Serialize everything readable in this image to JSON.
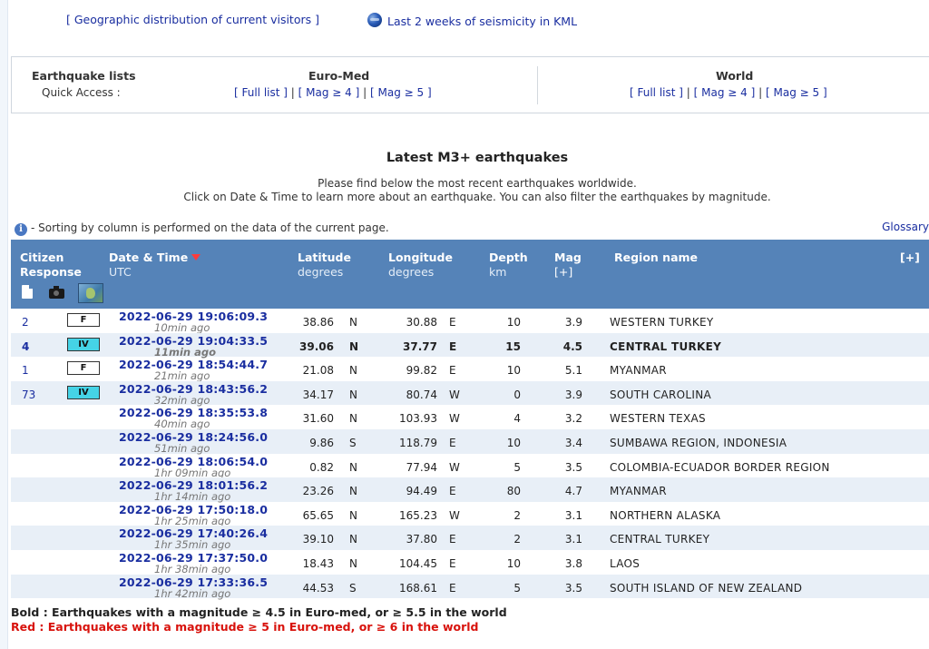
{
  "top_links": {
    "geo": "[ Geographic distribution of current visitors ]",
    "kml": "Last 2 weeks of seismicity in KML"
  },
  "quick_access": {
    "title": "Earthquake lists",
    "subtitle": "Quick Access :",
    "euromed": {
      "title": "Euro-Med",
      "full": "[ Full list ]",
      "mag4": "[ Mag ≥ 4 ]",
      "mag5": "[ Mag ≥ 5 ]"
    },
    "world": {
      "title": "World",
      "full": "[ Full list ]",
      "mag4": "[ Mag ≥ 4 ]",
      "mag5": "[ Mag ≥ 5 ]"
    },
    "separator": "|"
  },
  "main": {
    "title": "Latest M3+ earthquakes",
    "intro1": "Please find below the most recent earthquakes worldwide.",
    "intro2": "Click on Date & Time to learn more about an earthquake. You can also filter the earthquakes by magnitude.",
    "sort_note": "- Sorting by column is performed on the data of the current page.",
    "glossary": "Glossary"
  },
  "table": {
    "headers": {
      "citizen": "Citizen",
      "response": "Response",
      "date": "Date & Time",
      "date_sub": "UTC",
      "lat": "Latitude",
      "lat_sub": "degrees",
      "lon": "Longitude",
      "lon_sub": "degrees",
      "depth": "Depth",
      "depth_sub": "km",
      "mag": "Mag",
      "mag_sub": "[+]",
      "region": "Region name",
      "expand": "[+]"
    },
    "rows": [
      {
        "resp": "2",
        "int": "F",
        "date": "2022-06-29   19:06:09.3",
        "ago": "10min ago",
        "lat": "38.86",
        "ns": "N",
        "lon": "30.88",
        "ew": "E",
        "depth": "10",
        "mag": "3.9",
        "region": "WESTERN TURKEY",
        "bold": false
      },
      {
        "resp": "4",
        "int": "IV",
        "date": "2022-06-29   19:04:33.5",
        "ago": "11min ago",
        "lat": "39.06",
        "ns": "N",
        "lon": "37.77",
        "ew": "E",
        "depth": "15",
        "mag": "4.5",
        "region": "CENTRAL TURKEY",
        "bold": true
      },
      {
        "resp": "1",
        "int": "F",
        "date": "2022-06-29   18:54:44.7",
        "ago": "21min ago",
        "lat": "21.08",
        "ns": "N",
        "lon": "99.82",
        "ew": "E",
        "depth": "10",
        "mag": "5.1",
        "region": "MYANMAR",
        "bold": false
      },
      {
        "resp": "73",
        "int": "IV",
        "date": "2022-06-29   18:43:56.2",
        "ago": "32min ago",
        "lat": "34.17",
        "ns": "N",
        "lon": "80.74",
        "ew": "W",
        "depth": "0",
        "mag": "3.9",
        "region": "SOUTH CAROLINA",
        "bold": false
      },
      {
        "resp": "",
        "int": "",
        "date": "2022-06-29   18:35:53.8",
        "ago": "40min ago",
        "lat": "31.60",
        "ns": "N",
        "lon": "103.93",
        "ew": "W",
        "depth": "4",
        "mag": "3.2",
        "region": "WESTERN TEXAS",
        "bold": false
      },
      {
        "resp": "",
        "int": "",
        "date": "2022-06-29   18:24:56.0",
        "ago": "51min ago",
        "lat": "9.86",
        "ns": "S",
        "lon": "118.79",
        "ew": "E",
        "depth": "10",
        "mag": "3.4",
        "region": "SUMBAWA REGION, INDONESIA",
        "bold": false
      },
      {
        "resp": "",
        "int": "",
        "date": "2022-06-29   18:06:54.0",
        "ago": "1hr 09min ago",
        "lat": "0.82",
        "ns": "N",
        "lon": "77.94",
        "ew": "W",
        "depth": "5",
        "mag": "3.5",
        "region": "COLOMBIA-ECUADOR BORDER REGION",
        "bold": false
      },
      {
        "resp": "",
        "int": "",
        "date": "2022-06-29   18:01:56.2",
        "ago": "1hr 14min ago",
        "lat": "23.26",
        "ns": "N",
        "lon": "94.49",
        "ew": "E",
        "depth": "80",
        "mag": "4.7",
        "region": "MYANMAR",
        "bold": false
      },
      {
        "resp": "",
        "int": "",
        "date": "2022-06-29   17:50:18.0",
        "ago": "1hr 25min ago",
        "lat": "65.65",
        "ns": "N",
        "lon": "165.23",
        "ew": "W",
        "depth": "2",
        "mag": "3.1",
        "region": "NORTHERN ALASKA",
        "bold": false
      },
      {
        "resp": "",
        "int": "",
        "date": "2022-06-29   17:40:26.4",
        "ago": "1hr 35min ago",
        "lat": "39.10",
        "ns": "N",
        "lon": "37.80",
        "ew": "E",
        "depth": "2",
        "mag": "3.1",
        "region": "CENTRAL TURKEY",
        "bold": false
      },
      {
        "resp": "",
        "int": "",
        "date": "2022-06-29   17:37:50.0",
        "ago": "1hr 38min ago",
        "lat": "18.43",
        "ns": "N",
        "lon": "104.45",
        "ew": "E",
        "depth": "10",
        "mag": "3.8",
        "region": "LAOS",
        "bold": false
      },
      {
        "resp": "",
        "int": "",
        "date": "2022-06-29   17:33:36.5",
        "ago": "1hr 42min ago",
        "lat": "44.53",
        "ns": "S",
        "lon": "168.61",
        "ew": "E",
        "depth": "5",
        "mag": "3.5",
        "region": "SOUTH ISLAND OF NEW ZEALAND",
        "bold": false
      }
    ]
  },
  "legend": {
    "bold": "Bold : Earthquakes with a magnitude ≥ 4.5 in Euro-med, or ≥ 5.5 in the world",
    "red": "Red : Earthquakes with a magnitude ≥ 5 in Euro-med, or ≥ 6 in the world"
  },
  "colors": {
    "header_bg": "#5583b8",
    "row_alt": "#e8eff7",
    "link": "#1a2ea0",
    "intensity_iv": "#45d3e6",
    "red_legend": "#d8120c"
  }
}
